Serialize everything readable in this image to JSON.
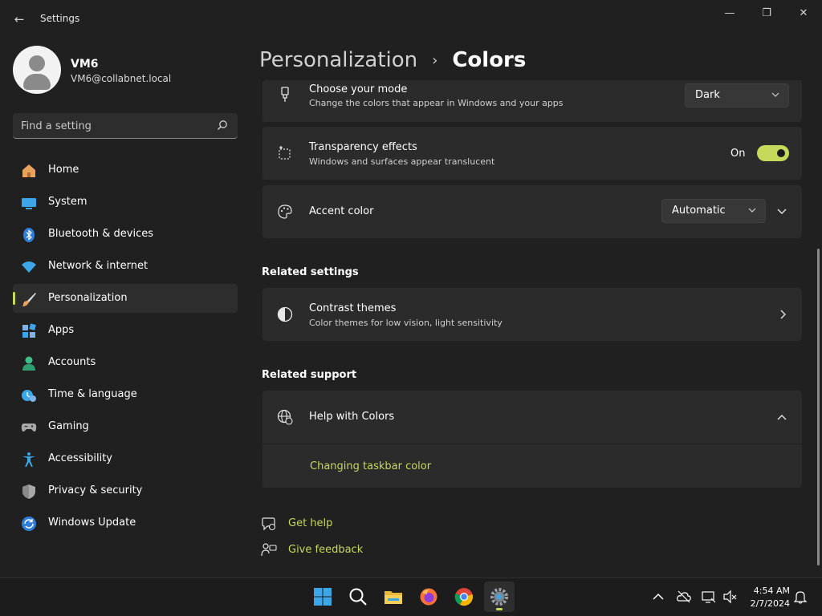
{
  "window": {
    "app_title": "Settings",
    "back_glyph": "←",
    "minimize_glyph": "—",
    "maximize_glyph": "❐",
    "close_glyph": "✕"
  },
  "profile": {
    "name": "VM6",
    "email": "VM6@collabnet.local"
  },
  "search": {
    "placeholder": "Find a setting",
    "icon": "search-icon"
  },
  "sidebar": {
    "items": [
      {
        "label": "Home",
        "icon": "home-icon"
      },
      {
        "label": "System",
        "icon": "system-icon"
      },
      {
        "label": "Bluetooth & devices",
        "icon": "bluetooth-icon"
      },
      {
        "label": "Network & internet",
        "icon": "wifi-icon"
      },
      {
        "label": "Personalization",
        "icon": "brush-icon",
        "active": true
      },
      {
        "label": "Apps",
        "icon": "apps-icon"
      },
      {
        "label": "Accounts",
        "icon": "accounts-icon"
      },
      {
        "label": "Time & language",
        "icon": "time-language-icon"
      },
      {
        "label": "Gaming",
        "icon": "gaming-icon"
      },
      {
        "label": "Accessibility",
        "icon": "accessibility-icon"
      },
      {
        "label": "Privacy & security",
        "icon": "shield-icon"
      },
      {
        "label": "Windows Update",
        "icon": "update-icon"
      }
    ]
  },
  "breadcrumb": {
    "parent": "Personalization",
    "separator": "›",
    "current": "Colors"
  },
  "settings": {
    "mode": {
      "title": "Choose your mode",
      "subtitle": "Change the colors that appear in Windows and your apps",
      "value": "Dark"
    },
    "transparency": {
      "title": "Transparency effects",
      "subtitle": "Windows and surfaces appear translucent",
      "state_label": "On",
      "enabled": true
    },
    "accent": {
      "title": "Accent color",
      "value": "Automatic"
    }
  },
  "related_settings": {
    "heading": "Related settings",
    "contrast": {
      "title": "Contrast themes",
      "subtitle": "Color themes for low vision, light sensitivity"
    }
  },
  "related_support": {
    "heading": "Related support",
    "help": {
      "title": "Help with Colors",
      "link": "Changing taskbar color"
    }
  },
  "footer_links": {
    "get_help": "Get help",
    "give_feedback": "Give feedback"
  },
  "taskbar": {
    "apps": [
      "windows-start-icon",
      "search-icon",
      "file-explorer-icon",
      "firefox-icon",
      "chrome-icon",
      "settings-icon"
    ],
    "time": "4:54 AM",
    "date": "2/7/2024"
  },
  "colors": {
    "accent": "#c7d95b",
    "background": "#202020",
    "card": "#2b2b2b"
  }
}
